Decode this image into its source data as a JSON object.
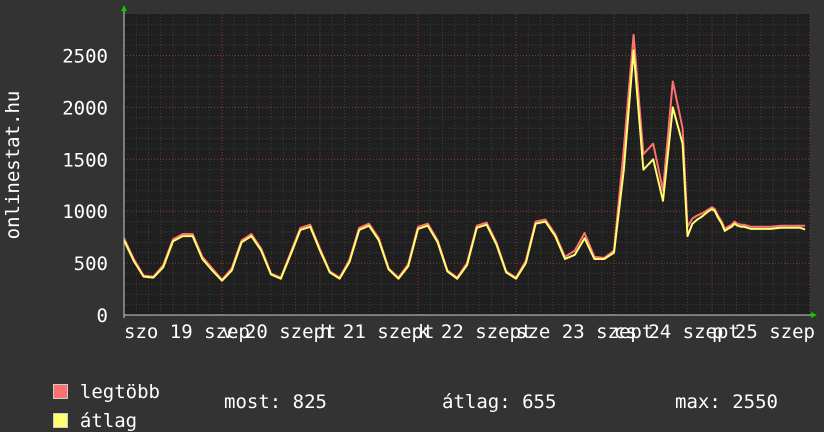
{
  "chart_data": {
    "type": "line",
    "ylabel": "onlinestat.hu",
    "xlabel": "",
    "title": "",
    "ylim": [
      0,
      2900
    ],
    "yticks": [
      0,
      500,
      1000,
      1500,
      2000,
      2500
    ],
    "x_range": [
      0,
      7.0
    ],
    "x_ticks": [
      {
        "pos": 0.0,
        "label": "szo 19 szep"
      },
      {
        "pos": 1.0,
        "label": "v 20 szept"
      },
      {
        "pos": 2.0,
        "label": "h 21 szept"
      },
      {
        "pos": 3.0,
        "label": "k 22 szept"
      },
      {
        "pos": 4.0,
        "label": "sze 23 szept"
      },
      {
        "pos": 5.0,
        "label": "cs 24 szept"
      },
      {
        "pos": 6.0,
        "label": "p 25 szep"
      }
    ],
    "grid": true,
    "legend_placement": "bottom-left",
    "series": [
      {
        "name": "legtöbb",
        "color": "#ff7070",
        "x": [
          0.0,
          0.1,
          0.2,
          0.3,
          0.4,
          0.5,
          0.6,
          0.7,
          0.8,
          0.9,
          1.0,
          1.1,
          1.2,
          1.3,
          1.4,
          1.5,
          1.6,
          1.7,
          1.8,
          1.9,
          2.0,
          2.1,
          2.2,
          2.3,
          2.4,
          2.5,
          2.6,
          2.7,
          2.8,
          2.9,
          3.0,
          3.1,
          3.2,
          3.3,
          3.4,
          3.5,
          3.6,
          3.7,
          3.8,
          3.9,
          4.0,
          4.1,
          4.2,
          4.3,
          4.4,
          4.5,
          4.6,
          4.7,
          4.8,
          4.9,
          5.0,
          5.1,
          5.2,
          5.3,
          5.4,
          5.5,
          5.6,
          5.7,
          5.75,
          5.8,
          5.85,
          5.9,
          5.95,
          6.0,
          6.03,
          6.06,
          6.1,
          6.13,
          6.16,
          6.2,
          6.23,
          6.26,
          6.3,
          6.33,
          6.36,
          6.4,
          6.5,
          6.6,
          6.7,
          6.8,
          6.9,
          6.95
        ],
        "values": [
          740,
          540,
          380,
          370,
          480,
          730,
          780,
          780,
          560,
          450,
          340,
          450,
          720,
          780,
          640,
          400,
          360,
          600,
          840,
          870,
          640,
          420,
          360,
          530,
          840,
          880,
          740,
          450,
          360,
          490,
          850,
          880,
          720,
          430,
          360,
          500,
          860,
          890,
          700,
          420,
          360,
          520,
          900,
          920,
          780,
          560,
          620,
          790,
          560,
          550,
          620,
          1600,
          2700,
          1550,
          1650,
          1200,
          2250,
          1800,
          850,
          930,
          960,
          980,
          1010,
          1040,
          1020,
          960,
          900,
          830,
          850,
          870,
          900,
          880,
          870,
          870,
          860,
          850,
          850,
          850,
          860,
          860,
          860,
          860
        ]
      },
      {
        "name": "átlag",
        "color": "#ffff70",
        "x": [
          0.0,
          0.1,
          0.2,
          0.3,
          0.4,
          0.5,
          0.6,
          0.7,
          0.8,
          0.9,
          1.0,
          1.1,
          1.2,
          1.3,
          1.4,
          1.5,
          1.6,
          1.7,
          1.8,
          1.9,
          2.0,
          2.1,
          2.2,
          2.3,
          2.4,
          2.5,
          2.6,
          2.7,
          2.8,
          2.9,
          3.0,
          3.1,
          3.2,
          3.3,
          3.4,
          3.5,
          3.6,
          3.7,
          3.8,
          3.9,
          4.0,
          4.1,
          4.2,
          4.3,
          4.4,
          4.5,
          4.6,
          4.7,
          4.8,
          4.9,
          5.0,
          5.1,
          5.2,
          5.3,
          5.4,
          5.5,
          5.6,
          5.7,
          5.75,
          5.8,
          5.85,
          5.9,
          5.95,
          6.0,
          6.03,
          6.06,
          6.1,
          6.13,
          6.16,
          6.2,
          6.23,
          6.26,
          6.3,
          6.33,
          6.36,
          6.4,
          6.5,
          6.6,
          6.7,
          6.8,
          6.9,
          6.95
        ],
        "values": [
          720,
          520,
          370,
          360,
          460,
          710,
          760,
          760,
          540,
          430,
          330,
          430,
          700,
          760,
          620,
          390,
          350,
          580,
          820,
          850,
          620,
          410,
          350,
          510,
          820,
          860,
          720,
          440,
          350,
          470,
          830,
          860,
          700,
          420,
          350,
          480,
          840,
          870,
          680,
          410,
          350,
          500,
          880,
          900,
          760,
          540,
          580,
          740,
          540,
          540,
          600,
          1400,
          2550,
          1400,
          1500,
          1100,
          2000,
          1650,
          760,
          880,
          920,
          950,
          990,
          1020,
          1000,
          940,
          880,
          810,
          830,
          850,
          880,
          860,
          850,
          850,
          840,
          830,
          830,
          830,
          840,
          840,
          840,
          825
        ]
      }
    ]
  },
  "legend": {
    "items": [
      {
        "label": "legtöbb",
        "color": "#ff7070"
      },
      {
        "label": "átlag",
        "color": "#ffff70"
      }
    ]
  },
  "stats": {
    "most": "most: 825",
    "atlag": "átlag: 655",
    "max": "max: 2550"
  }
}
